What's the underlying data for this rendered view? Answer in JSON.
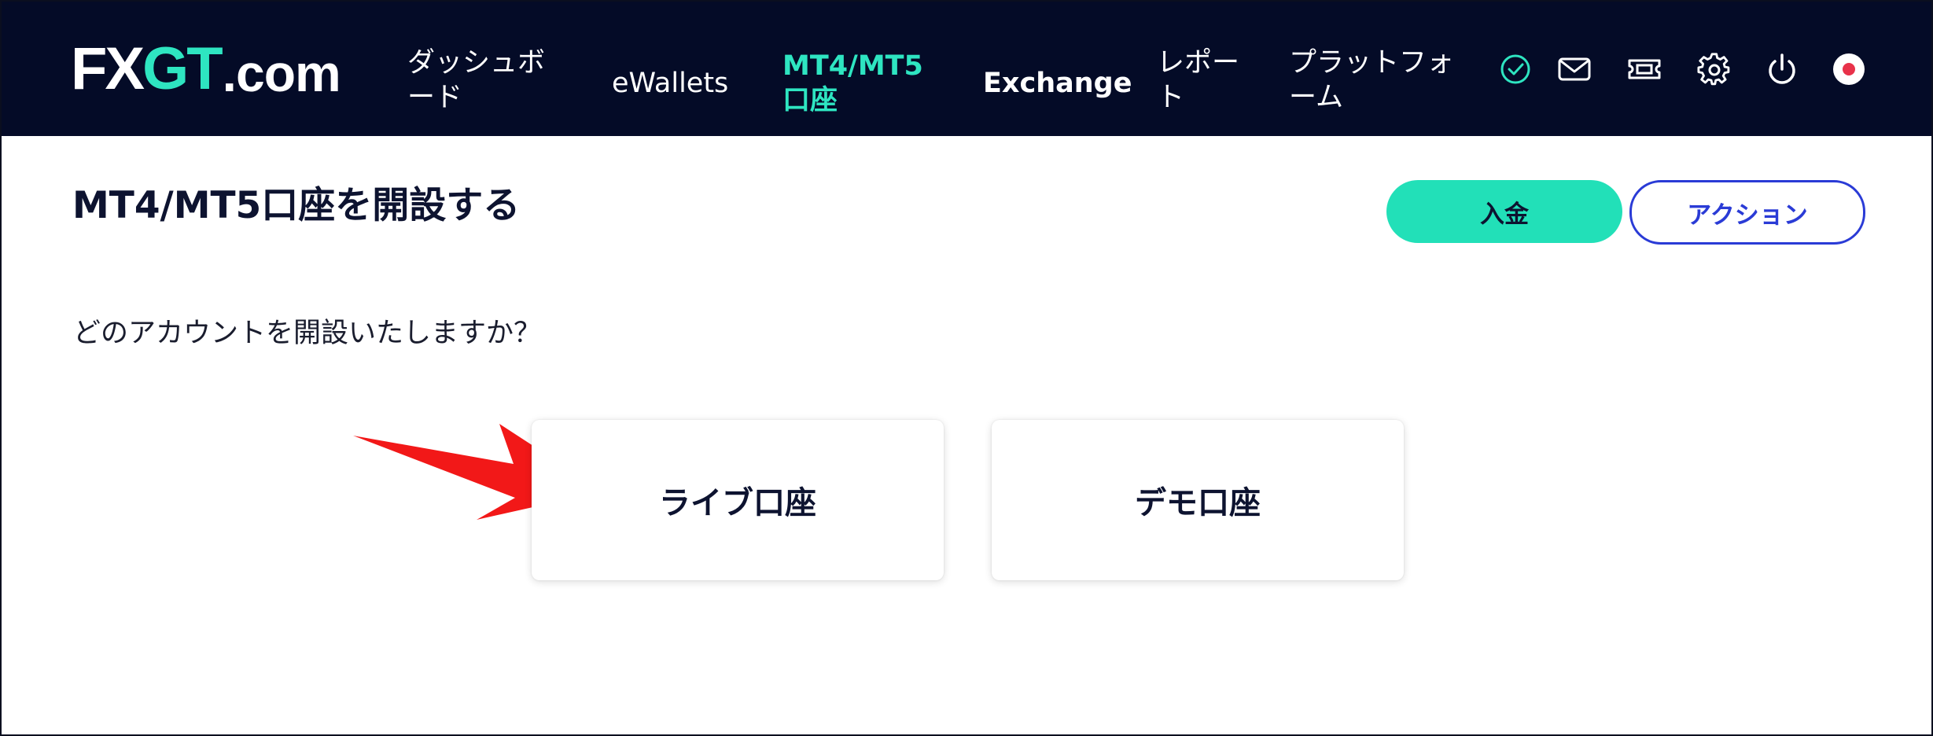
{
  "logo": {
    "part1": "FX",
    "part2": "GT",
    "part3": ".com"
  },
  "nav": {
    "dashboard_line1": "ダッシュボ",
    "dashboard_line2": "ード",
    "ewallets": "eWallets",
    "mt_line1": "MT4/MT5",
    "mt_line2": "口座",
    "exchange": "Exchange",
    "report_line1": "レポー",
    "report_line2": "ト",
    "platform_line1": "プラットフォ",
    "platform_line2": "ーム"
  },
  "header_icons": [
    "verified-check-icon",
    "mail-icon",
    "ticket-icon",
    "gear-icon",
    "power-icon",
    "japan-flag-icon"
  ],
  "colors": {
    "header_bg": "#040b27",
    "accent": "#2ee5c1",
    "deposit_bg": "#22e0b8",
    "action_blue": "#2a3bd6",
    "arrow_red": "#f21818"
  },
  "main": {
    "title": "MT4/MT5口座を開設する",
    "deposit_label": "入金",
    "action_label": "アクション",
    "question": "どのアカウントを開設いたしますか？",
    "live_account_label": "ライブ口座",
    "demo_account_label": "デモ口座"
  }
}
